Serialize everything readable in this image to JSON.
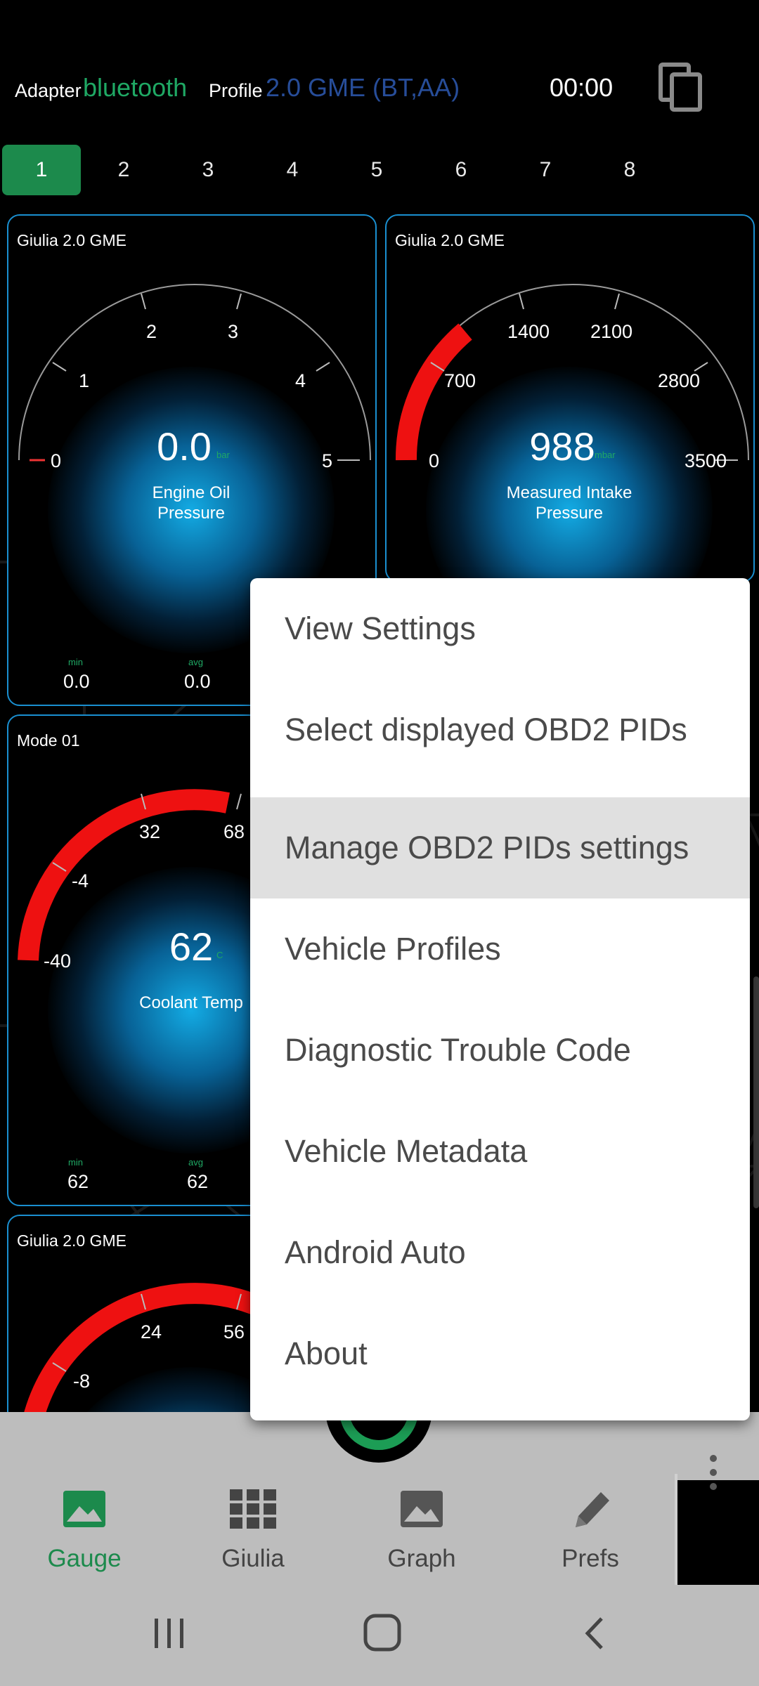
{
  "header": {
    "adapter_label": "Adapter",
    "adapter_value": "bluetooth",
    "profile_label": "Profile",
    "profile_value": "2.0 GME (BT,AA)",
    "timer": "00:00",
    "copy_icon": "copy-icon"
  },
  "tabs": [
    {
      "label": "1",
      "active": true
    },
    {
      "label": "2"
    },
    {
      "label": "3"
    },
    {
      "label": "4"
    },
    {
      "label": "5"
    },
    {
      "label": "6"
    },
    {
      "label": "7"
    },
    {
      "label": "8"
    }
  ],
  "gauges": [
    {
      "title": "Giulia 2.0 GME",
      "value": "0.0",
      "unit": "bar",
      "name_line1": "Engine Oil",
      "name_line2": "Pressure",
      "ticks": [
        "0",
        "1",
        "2",
        "3",
        "4",
        "5"
      ],
      "min_label": "min",
      "min_value": "0.0",
      "avg_label": "avg",
      "avg_value": "0.0"
    },
    {
      "title": "Giulia 2.0 GME",
      "value": "988",
      "unit": "mbar",
      "name_line1": "Measured Intake",
      "name_line2": "Pressure",
      "ticks": [
        "0",
        "700",
        "1400",
        "2100",
        "2800",
        "3500"
      ]
    },
    {
      "title": "Mode 01",
      "value": "62",
      "unit": "C",
      "name_line1": "Coolant Temp",
      "ticks": [
        "-40",
        "-4",
        "32",
        "68"
      ],
      "min_label": "min",
      "min_value": "62",
      "avg_label": "avg",
      "avg_value": "62"
    },
    {
      "title": "Giulia 2.0 GME",
      "ticks": [
        "-8",
        "24",
        "56"
      ]
    }
  ],
  "menu": {
    "items": [
      {
        "label": "View Settings"
      },
      {
        "label": "Select displayed OBD2 PIDs"
      },
      {
        "label": "Manage OBD2 PIDs settings",
        "highlighted": true
      },
      {
        "label": "Vehicle Profiles"
      },
      {
        "label": "Diagnostic Trouble Code"
      },
      {
        "label": "Vehicle Metadata"
      },
      {
        "label": "Android Auto"
      },
      {
        "label": "About"
      }
    ]
  },
  "bottom_nav": [
    {
      "label": "Gauge",
      "icon": "image-icon",
      "active": true
    },
    {
      "label": "Giulia",
      "icon": "grid-icon"
    },
    {
      "label": "Graph",
      "icon": "image-icon"
    },
    {
      "label": "Prefs",
      "icon": "pencil-icon"
    }
  ],
  "colors": {
    "accent_green": "#1c8a4c",
    "gauge_border": "#1a8fd0",
    "profile_blue": "#274d99",
    "gauge_red": "#ee1111"
  }
}
